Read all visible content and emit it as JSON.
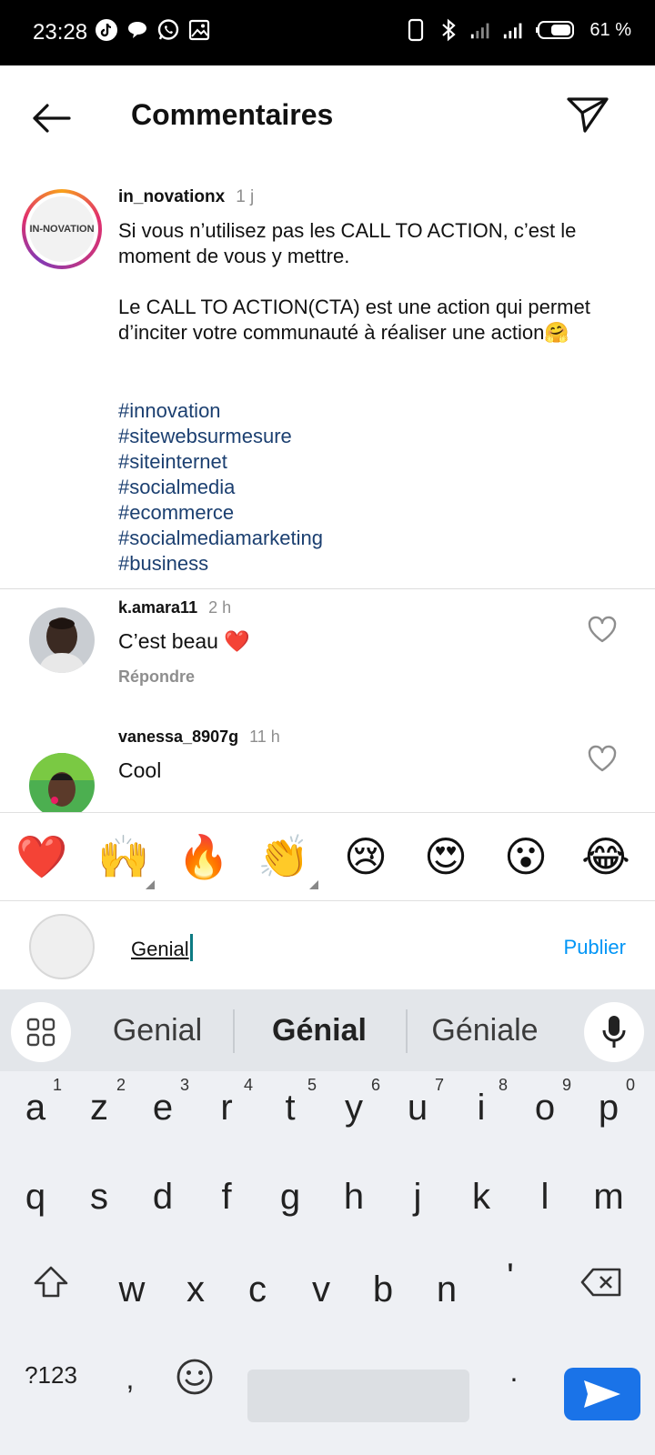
{
  "status_bar": {
    "time": "23:28",
    "battery": "61 %",
    "left_icons": [
      "tiktok-icon",
      "chat-bubble-icon",
      "whatsapp-icon",
      "gallery-icon"
    ],
    "right_icons": [
      "vibrate-icon",
      "bluetooth-icon",
      "signal-icon",
      "signal-icon",
      "battery-icon"
    ]
  },
  "header": {
    "title": "Commentaires"
  },
  "caption": {
    "username": "in_novationx",
    "time": "1 j",
    "avatar_label": "IN-NOVATION",
    "text": "Si vous n’utilisez pas les CALL TO ACTION, c’est le moment de vous y mettre.\n\nLe CALL TO ACTION(CTA) est une action qui permet d’inciter votre communauté à réaliser une action🤗",
    "hashtags": [
      "#innovation",
      "#sitewebsurmesure",
      "#siteinternet",
      "#socialmedia",
      "#ecommerce",
      "#socialmediamarketing",
      "#business"
    ]
  },
  "comments": [
    {
      "username": "k.amara11",
      "time": "2 h",
      "text": "C’est beau ❤️",
      "reply": "Répondre"
    },
    {
      "username": "vanessa_8907g",
      "time": "11 h",
      "text": "Cool"
    }
  ],
  "emoji_bar": [
    "❤️",
    "🙌",
    "🔥",
    "👏",
    "😢",
    "😍",
    "😮",
    "😂"
  ],
  "input": {
    "value": "Genial",
    "publish": "Publier"
  },
  "keyboard": {
    "suggestions": [
      "Genial",
      "Génial",
      "Géniale"
    ],
    "row1": [
      "a",
      "z",
      "e",
      "r",
      "t",
      "y",
      "u",
      "i",
      "o",
      "p"
    ],
    "row1_nums": [
      "1",
      "2",
      "3",
      "4",
      "5",
      "6",
      "7",
      "8",
      "9",
      "0"
    ],
    "row2": [
      "q",
      "s",
      "d",
      "f",
      "g",
      "h",
      "j",
      "k",
      "l",
      "m"
    ],
    "row3": [
      "w",
      "x",
      "c",
      "v",
      "b",
      "n",
      "'"
    ],
    "symbols_key": "?123",
    "comma_key": ",",
    "period_key": "."
  },
  "colors": {
    "hashtag": "#1b3f70",
    "publish": "#0095f6",
    "enter_key": "#1a73e8",
    "heart": "#e0245e"
  }
}
